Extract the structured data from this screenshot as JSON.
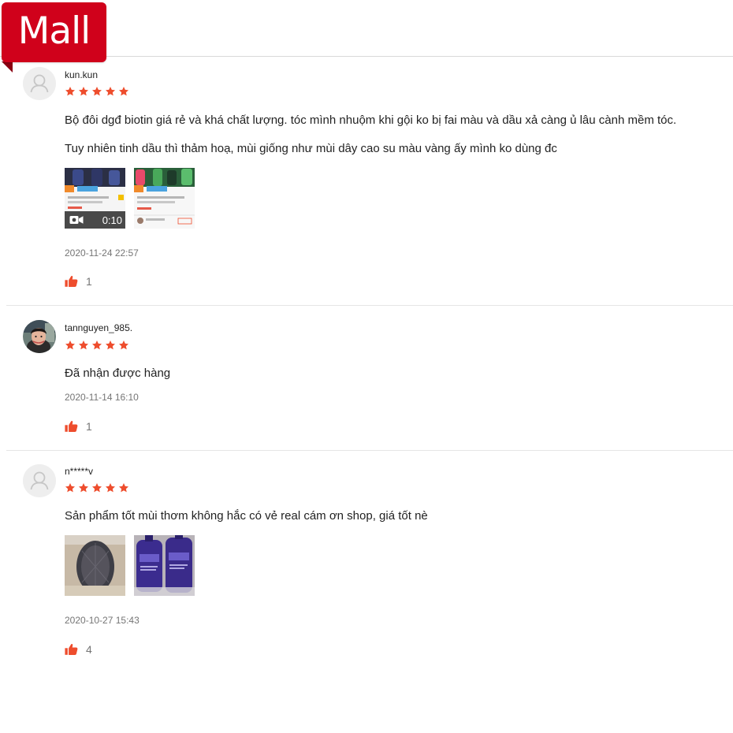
{
  "badge": {
    "label": "Mall"
  },
  "colors": {
    "brand": "#d0011b",
    "star": "#ee4d2d",
    "like": "#ee4d2d"
  },
  "reviews": [
    {
      "username": "kun.kun",
      "rating": 5,
      "comment_lines": [
        "Bộ đôi dgđ biotin giá rẻ và khá chất lượng. tóc mình nhuộm khi gội ko bị fai màu và dầu xả càng ủ lâu cành mềm tóc.",
        "Tuy nhiên tinh dầu thì thảm hoạ, mùi giống như mùi dây cao su màu vàng ấy mình ko dùng đc"
      ],
      "media": [
        {
          "type": "video",
          "duration": "0:10",
          "icon": "video-camera-icon"
        },
        {
          "type": "image"
        }
      ],
      "date": "2020-11-24 22:57",
      "likes": "1"
    },
    {
      "username": "tannguyen_985.",
      "rating": 5,
      "comment_lines": [
        "Đã nhận được hàng"
      ],
      "media": [],
      "date": "2020-11-14 16:10",
      "likes": "1"
    },
    {
      "username": "n*****v",
      "rating": 5,
      "comment_lines": [
        "Sản phẩm tốt mùi thơm không hắc có vẻ real cám ơn shop, giá tốt nè"
      ],
      "media": [
        {
          "type": "image"
        },
        {
          "type": "image"
        }
      ],
      "date": "2020-10-27 15:43",
      "likes": "4"
    }
  ]
}
